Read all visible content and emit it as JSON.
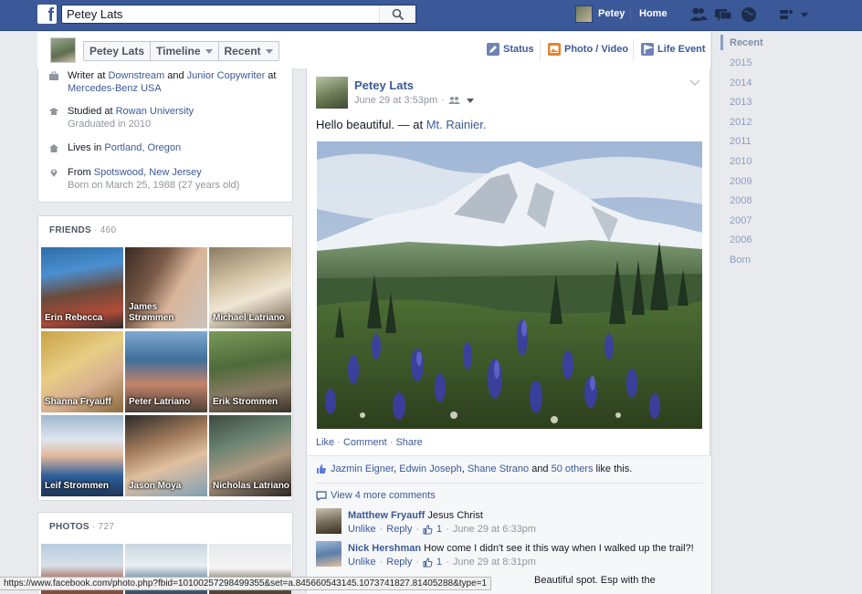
{
  "topbar": {
    "search_value": "Petey Lats",
    "user_name": "Petey",
    "home_label": "Home"
  },
  "profile_nav": {
    "name_button": "Petey Lats",
    "timeline_button": "Timeline",
    "recent_button": "Recent",
    "composer": {
      "status": "Status",
      "photo_video": "Photo / Video",
      "life_event": "Life Event"
    }
  },
  "about": {
    "work": {
      "prefix": "Writer",
      "at1": " at ",
      "employer1": "Downstream",
      "and": " and ",
      "role2": "Junior Copywriter",
      "at2": " at ",
      "employer2": "Mercedes-Benz USA"
    },
    "education": {
      "prefix": "Studied at ",
      "school": "Rowan University",
      "sub": "Graduated in 2010"
    },
    "lives": {
      "prefix": "Lives in ",
      "place": "Portland, Oregon"
    },
    "from": {
      "prefix": "From ",
      "place": "Spotswood, New Jersey",
      "sub": "Born on March 25, 1988 (27 years old)"
    }
  },
  "friends": {
    "title": "FRIENDS",
    "count": "460",
    "items": [
      {
        "name": "Erin Rebecca"
      },
      {
        "name_line1": "James",
        "name_line2": "Strømmen"
      },
      {
        "name": "Michael Latriano"
      },
      {
        "name": "Shanna Fryauff"
      },
      {
        "name": "Peter Latriano"
      },
      {
        "name": "Erik Strommen"
      },
      {
        "name": "Leif Strommen"
      },
      {
        "name": "Jason Moya"
      },
      {
        "name": "Nicholas Latriano"
      }
    ]
  },
  "photos": {
    "title": "PHOTOS",
    "count": "727"
  },
  "post": {
    "author": "Petey Lats",
    "time": "June 29 at 3:53pm",
    "text_prefix": "Hello beautiful. — at ",
    "place": "Mt. Rainier.",
    "actions": {
      "like": "Like",
      "comment": "Comment",
      "share": "Share"
    },
    "likes": {
      "name1": "Jazmin Eigner",
      "name2": "Edwin Joseph",
      "name3": "Shane Strano",
      "and": "and",
      "others": "50 others",
      "suffix": "like this."
    },
    "view_more": "View 4 more comments",
    "comments": [
      {
        "author": "Matthew Fryauff",
        "text": "Jesus Christ",
        "unlike": "Unlike",
        "reply": "Reply",
        "likes": "1",
        "time": "June 29 at 6:33pm"
      },
      {
        "author": "Nick Hershman",
        "text": "How come I didn't see it this way when I walked up the trail?!",
        "unlike": "Unlike",
        "reply": "Reply",
        "likes": "1",
        "time": "June 29 at 8:31pm"
      }
    ],
    "partial_comment": "Beautiful spot. Esp with the"
  },
  "year_rail": [
    "Recent",
    "2015",
    "2014",
    "2013",
    "2012",
    "2011",
    "2010",
    "2009",
    "2008",
    "2007",
    "2006",
    "Born"
  ],
  "status_bar": "https://www.facebook.com/photo.php?fbid=10100257298499355&set=a.845660543145.1073741827.81405288&type=1",
  "colors": {
    "brand": "#3b5998",
    "topbar_border": "#29487d",
    "page_bg": "#e9eaed",
    "link": "#3b5998",
    "muted": "#90949c"
  }
}
